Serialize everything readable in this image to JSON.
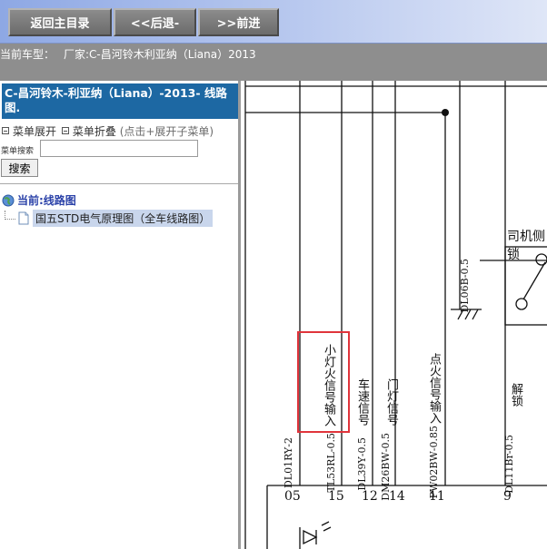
{
  "toolbar": {
    "home_label": "返回主目录",
    "back_label": "<<后退-",
    "forward_label": ">>前进"
  },
  "model_bar": {
    "label": "当前车型：",
    "value": "厂家:C-昌河铃木利亚纳（Liana）2013"
  },
  "sidebar": {
    "title": "C-昌河铃木-利亚纳（Liana）-2013- 线路图.",
    "expand_label": "菜单展开",
    "collapse_label": "菜单折叠",
    "collapse_hint": "(点击+展开子菜单)",
    "search_label": "菜单搜索",
    "search_value": "",
    "search_button": "搜索",
    "tree_root": "当前:线路图",
    "tree_child": "国五STD电气原理图（全车线路图）"
  },
  "diagram": {
    "signals": [
      {
        "name": "小灯火信号输入",
        "code": "TL53RL",
        "gauge": "0.5",
        "pin": "15"
      },
      {
        "name": "车速信号",
        "code": "DL39Y",
        "gauge": "0.5",
        "pin": "12"
      },
      {
        "name": "门灯信号",
        "code": "DM26BW",
        "gauge": "0.5",
        "pin": "14"
      },
      {
        "name": "点火信号输入",
        "code": "PW02BW",
        "gauge": "0.85",
        "pin": "11"
      },
      {
        "name": "解锁",
        "code": "DL11Br",
        "gauge": "0.5",
        "pin": "9"
      }
    ],
    "first_wire": {
      "code": "DL01RY",
      "gauge": "2",
      "pin": "05"
    },
    "ground_wire": {
      "code": "DL06B",
      "gauge": "0.5"
    },
    "box_label": "司机侧锁"
  },
  "colors": {
    "toolbar_gradient_start": "#8ea8e4",
    "button_gray": "#7a7a7a",
    "model_bar_bg": "#8e8e8e",
    "sidebar_title_bg": "#1d68a3",
    "tree_root_text": "#2a41a8",
    "highlight_red": "#e0343b"
  }
}
